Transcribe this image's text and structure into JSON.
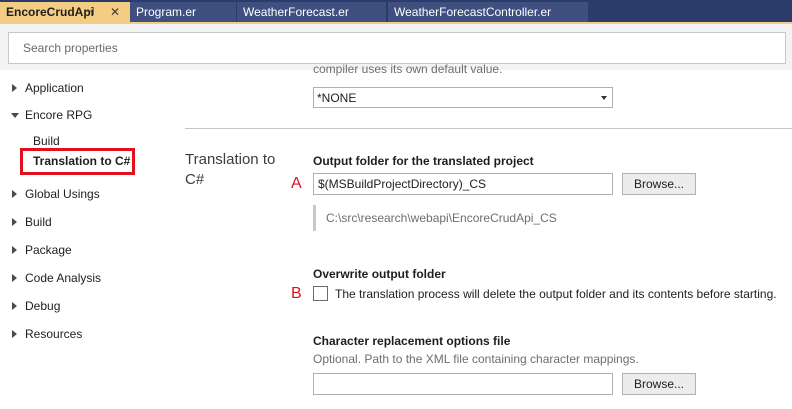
{
  "tabs": [
    {
      "label": "EncoreCrudApi",
      "active": true,
      "pin_glyph": "⊣",
      "close_glyph": "✕"
    },
    {
      "label": "Program.er",
      "active": false
    },
    {
      "label": "WeatherForecast.er",
      "active": false
    },
    {
      "label": "WeatherForecastController.er",
      "active": false
    }
  ],
  "search": {
    "placeholder": "Search properties",
    "value": ""
  },
  "sidebar": {
    "items": [
      {
        "label": "Application",
        "expander": "collapsed"
      },
      {
        "label": "Encore RPG",
        "expander": "expanded",
        "children": [
          {
            "label": "Build"
          },
          {
            "label": "Translation to C#",
            "selected": true
          }
        ]
      },
      {
        "label": "Global Usings",
        "expander": "collapsed"
      },
      {
        "label": "Build",
        "expander": "collapsed"
      },
      {
        "label": "Package",
        "expander": "collapsed"
      },
      {
        "label": "Code Analysis",
        "expander": "collapsed"
      },
      {
        "label": "Debug",
        "expander": "collapsed"
      },
      {
        "label": "Resources",
        "expander": "collapsed"
      }
    ]
  },
  "main": {
    "partial_text": "compiler uses its own default value.",
    "dropdown_value": "*NONE",
    "section_title": "Translation to C#",
    "output_folder": {
      "label": "Output folder for the translated project",
      "value": "$(MSBuildProjectDirectory)_CS",
      "browse_label": "Browse...",
      "resolved_path": "C:\\src\\research\\webapi\\EncoreCrudApi_CS",
      "marker": "A"
    },
    "overwrite": {
      "label": "Overwrite output folder",
      "checkbox_label": "The translation process will delete the output folder and its contents before starting.",
      "checked": false,
      "marker": "B"
    },
    "char_replacement": {
      "label": "Character replacement options file",
      "description": "Optional. Path to the XML file containing character mappings.",
      "value": "",
      "browse_label": "Browse..."
    }
  },
  "colors": {
    "tabbar": "#2b3c6b",
    "active_tab": "#f5cc84",
    "highlight": "#e0111b",
    "marker": "#e0111b"
  }
}
